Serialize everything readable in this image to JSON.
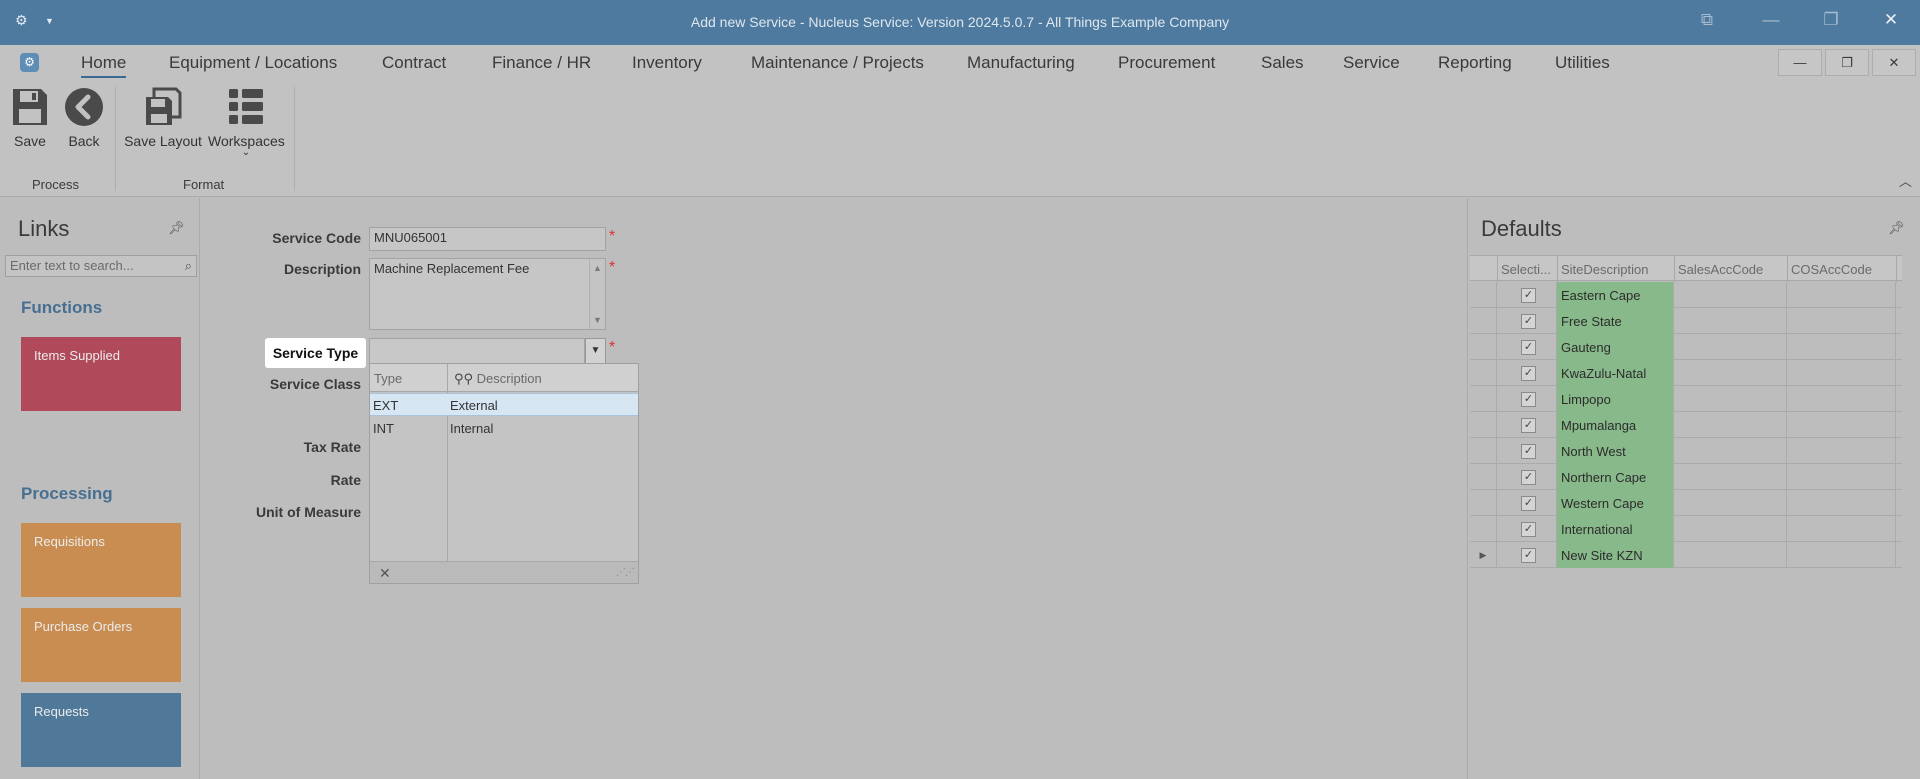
{
  "window": {
    "title": "Add new Service - Nucleus Service: Version 2024.5.0.7 - All Things Example Company"
  },
  "menu": {
    "items": [
      "Home",
      "Equipment / Locations",
      "Contract",
      "Finance / HR",
      "Inventory",
      "Maintenance / Projects",
      "Manufacturing",
      "Procurement",
      "Sales",
      "Service",
      "Reporting",
      "Utilities"
    ],
    "active": "Home"
  },
  "ribbon": {
    "save": "Save",
    "back": "Back",
    "save_layout": "Save Layout",
    "workspaces": "Workspaces",
    "group_process": "Process",
    "group_format": "Format"
  },
  "links": {
    "title": "Links",
    "search_placeholder": "Enter text to search...",
    "functions_heading": "Functions",
    "processing_heading": "Processing",
    "tiles": {
      "items_supplied": "Items Supplied",
      "requisitions": "Requisitions",
      "purchase_orders": "Purchase Orders",
      "requests": "Requests"
    },
    "colors": {
      "items_supplied": "#b04a5a",
      "requisitions": "#c98d52",
      "purchase_orders": "#c98d52",
      "requests": "#4f7899"
    }
  },
  "form": {
    "service_code_label": "Service Code",
    "service_code_value": "MNU065001",
    "description_label": "Description",
    "description_value": "Machine Replacement Fee",
    "service_type_label": "Service Type",
    "service_type_value": "",
    "service_class_label": "Service Class",
    "tax_rate_label": "Tax Rate",
    "rate_label": "Rate",
    "unit_of_measure_label": "Unit of Measure",
    "required_mark": "*"
  },
  "service_type_popup": {
    "col_type": "Type",
    "col_description": "Description",
    "rows": [
      {
        "type": "EXT",
        "description": "External",
        "selected": true
      },
      {
        "type": "INT",
        "description": "Internal",
        "selected": false
      }
    ]
  },
  "defaults": {
    "title": "Defaults",
    "columns": [
      "Selecti...",
      "SiteDescription",
      "SalesAccCode",
      "COSAccCode"
    ],
    "rows": [
      {
        "site": "Eastern Cape",
        "checked": true
      },
      {
        "site": "Free State",
        "checked": true
      },
      {
        "site": "Gauteng",
        "checked": true
      },
      {
        "site": "KwaZulu-Natal",
        "checked": true
      },
      {
        "site": "Limpopo",
        "checked": true
      },
      {
        "site": "Mpumalanga",
        "checked": true
      },
      {
        "site": "North West",
        "checked": true
      },
      {
        "site": "Northern Cape",
        "checked": true
      },
      {
        "site": "Western Cape",
        "checked": true
      },
      {
        "site": "International",
        "checked": true
      },
      {
        "site": "New Site KZN",
        "checked": true,
        "current": true
      }
    ]
  }
}
